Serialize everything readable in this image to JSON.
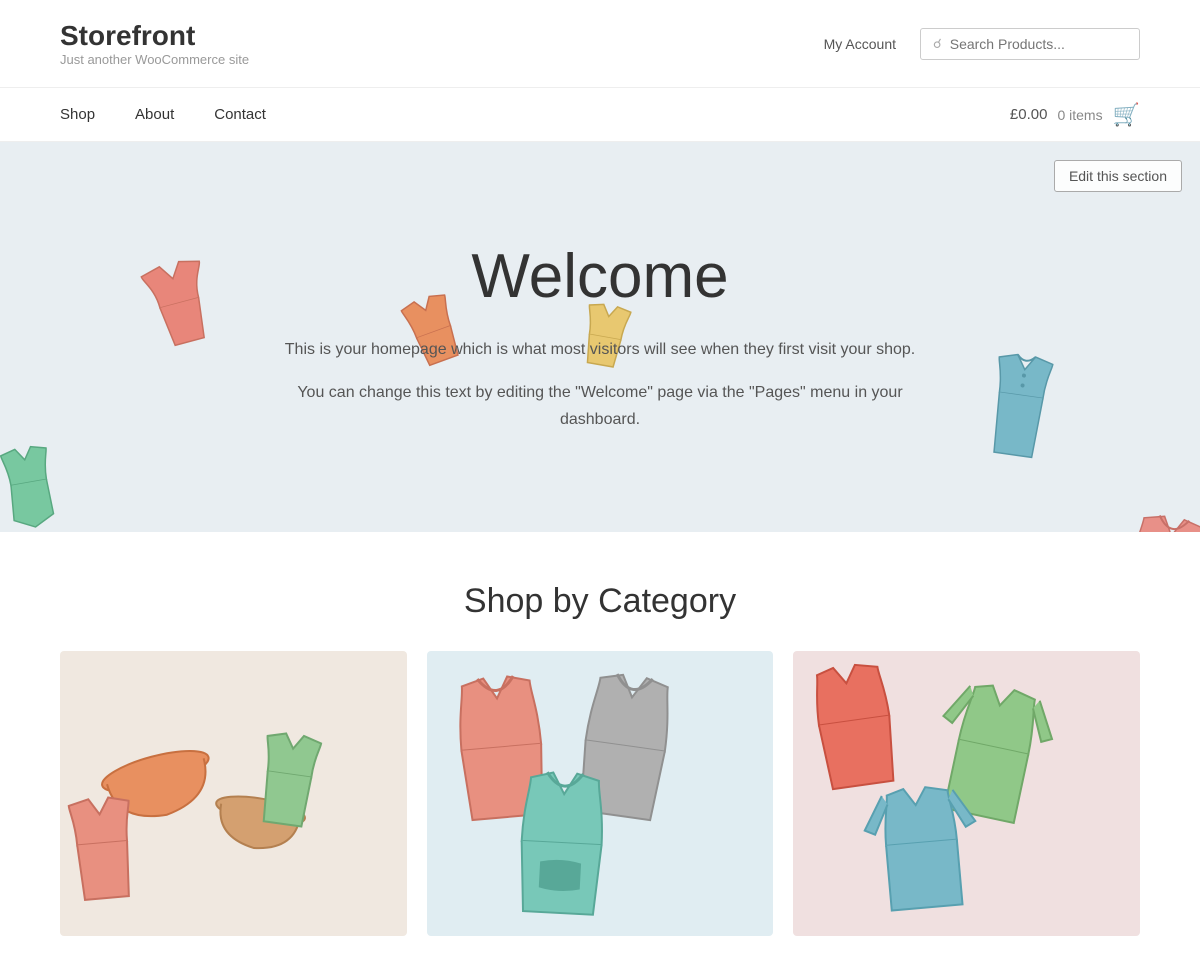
{
  "header": {
    "logo_title": "Storefront",
    "logo_subtitle": "Just another WooCommerce site",
    "my_account_label": "My Account",
    "search_placeholder": "Search Products..."
  },
  "nav": {
    "links": [
      {
        "label": "Shop",
        "id": "shop"
      },
      {
        "label": "About",
        "id": "about"
      },
      {
        "label": "Contact",
        "id": "contact"
      }
    ],
    "cart_price": "£0.00",
    "cart_items": "0 items"
  },
  "hero": {
    "edit_label": "Edit this section",
    "title": "Welcome",
    "text1": "This is your homepage which is what most visitors will see when they first visit your shop.",
    "text2": "You can change this text by editing the \"Welcome\" page via the \"Pages\" menu in your dashboard."
  },
  "shop_section": {
    "title": "Shop by Category"
  },
  "colors": {
    "accent": "#96588a",
    "bg_hero": "#e8eef2",
    "cat1_bg": "#f2e8e0",
    "cat2_bg": "#e0eef2",
    "cat3_bg": "#f2e0e0"
  }
}
